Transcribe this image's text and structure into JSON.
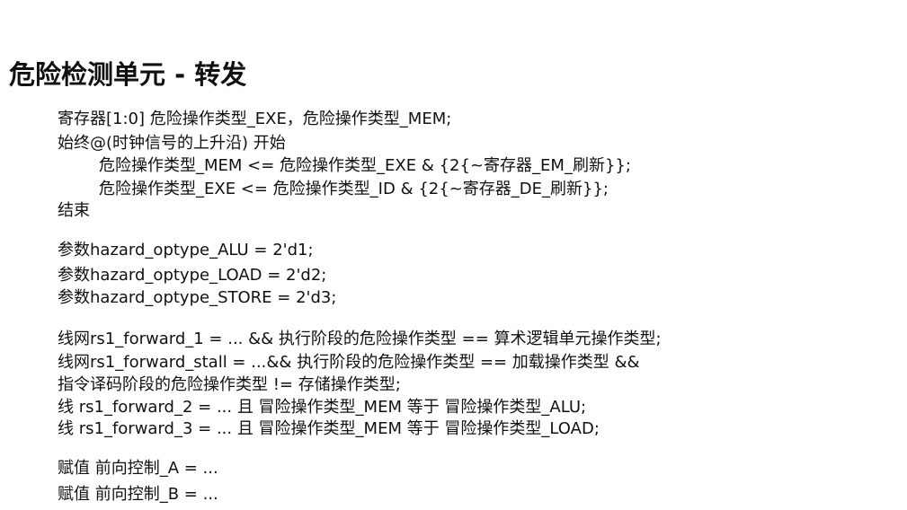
{
  "slide": {
    "title": "危险检测单元 - 转发"
  },
  "code": {
    "block1": {
      "line1": "寄存器[1:0] 危险操作类型_EXE，危险操作类型_MEM;",
      "line2": "始终@(时钟信号的上升沿) 开始",
      "line3": "危险操作类型_MEM <= 危险操作类型_EXE & {2{~寄存器_EM_刷新}};",
      "line4": "危险操作类型_EXE <= 危险操作类型_ID & {2{~寄存器_DE_刷新}};",
      "line5": "结束"
    },
    "block2": {
      "line1": "参数hazard_optype_ALU = 2'd1;",
      "line2": "参数hazard_optype_LOAD = 2'd2;",
      "line3": "参数hazard_optype_STORE = 2'd3;"
    },
    "block3": {
      "line1": "线网rs1_forward_1 = ... && 执行阶段的危险操作类型 == 算术逻辑单元操作类型;",
      "line2": "线网rs1_forward_stall = ...&& 执行阶段的危险操作类型 == 加载操作类型 &&",
      "line3": "指令译码阶段的危险操作类型 != 存储操作类型;",
      "line4": "线 rs1_forward_2 = ... 且 冒险操作类型_MEM 等于 冒险操作类型_ALU;",
      "line5": "线 rs1_forward_3 = ... 且 冒险操作类型_MEM 等于 冒险操作类型_LOAD;"
    },
    "block4": {
      "line1": "赋值 前向控制_A = ...",
      "line2": "赋值 前向控制_B = ..."
    }
  }
}
